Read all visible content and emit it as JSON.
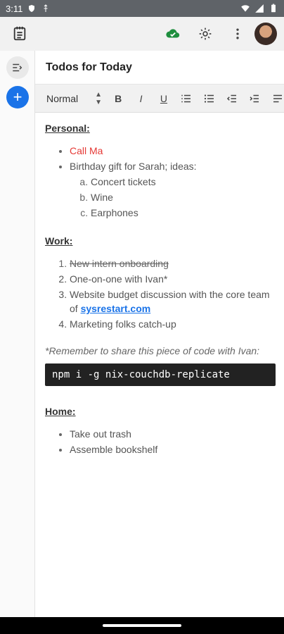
{
  "status_bar": {
    "time": "3:11"
  },
  "app_bar": {
    "icons": [
      "notebook-icon",
      "cloud-check-icon",
      "gear-icon",
      "more-vert-icon"
    ]
  },
  "sidebar": {
    "icons": [
      "collapse-menu-icon",
      "add-icon"
    ],
    "add_label": "+"
  },
  "note": {
    "title": "Todos for Today"
  },
  "toolbar": {
    "format_select": "Normal",
    "buttons": [
      "B",
      "I",
      "U"
    ]
  },
  "content": {
    "personal": {
      "heading": "Personal",
      "items": [
        {
          "text": "Call Ma",
          "color": "#e53935"
        },
        {
          "text": "Birthday gift for Sarah; ideas:"
        }
      ],
      "subitems": [
        "Concert tickets",
        "Wine",
        "Earphones"
      ]
    },
    "work": {
      "heading": "Work",
      "items": [
        {
          "text": "New intern onboarding"
        },
        {
          "text": "One-on-one with Ivan*"
        },
        {
          "text_prefix": "Website budget discussion with the core team of ",
          "link": "sysrestart.com"
        },
        {
          "text": "Marketing folks catch-up"
        }
      ]
    },
    "note": "*Remember to share this piece of code with Ivan:",
    "code": "npm i -g nix-couchdb-replicate",
    "home": {
      "heading": "Home",
      "items": [
        "Take out trash",
        "Assemble bookshelf"
      ]
    }
  },
  "colors": {
    "accent": "#1a73e8",
    "sync_green": "#1e8e3e",
    "status_bar": "#5f6368"
  }
}
